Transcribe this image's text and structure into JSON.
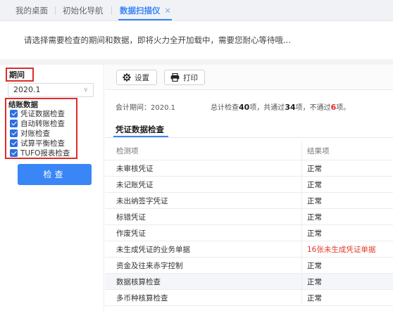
{
  "tabs": [
    {
      "label": "我的桌面"
    },
    {
      "label": "初始化导航"
    },
    {
      "label": "数据扫描仪",
      "active": true,
      "close": "✕"
    }
  ],
  "hint": "请选择需要检查的期间和数据，即将火力全开加载中，需要您耐心等待哦...",
  "left": {
    "period_title": "期间",
    "period_value": "2020.1",
    "group_title": "结账数据",
    "checks": [
      {
        "label": "凭证数据检查",
        "checked": true
      },
      {
        "label": "自动转账检查",
        "checked": true
      },
      {
        "label": "对账检查",
        "checked": true
      },
      {
        "label": "试算平衡检查",
        "checked": true
      },
      {
        "label": "TUFO报表检查",
        "checked": true
      }
    ],
    "check_button": "检查"
  },
  "toolbar": {
    "settings_label": "设置",
    "print_label": "打印"
  },
  "summary": {
    "period_label": "会计期间：2020.1",
    "total_prefix": "总计检查",
    "total": "40",
    "total_unit": "项，共通过",
    "passed": "34",
    "passed_unit": "项，不通过",
    "failed": "6",
    "failed_unit": "项。"
  },
  "section_title": "凭证数据检查",
  "table": {
    "headers": [
      "检测项",
      "结果项"
    ],
    "rows": [
      {
        "item": "未审核凭证",
        "result": "正常",
        "warn": false
      },
      {
        "item": "未记账凭证",
        "result": "正常",
        "warn": false
      },
      {
        "item": "未出纳签字凭证",
        "result": "正常",
        "warn": false
      },
      {
        "item": "标错凭证",
        "result": "正常",
        "warn": false
      },
      {
        "item": "作废凭证",
        "result": "正常",
        "warn": false
      },
      {
        "item": "未生成凭证的业务单据",
        "result": "16张未生成凭证单据",
        "warn": true
      },
      {
        "item": "资金及往来赤字控制",
        "result": "正常",
        "warn": false
      },
      {
        "item": "数据核算检查",
        "result": "正常",
        "warn": false
      },
      {
        "item": "多币种核算检查",
        "result": "正常",
        "warn": false
      }
    ]
  },
  "colors": {
    "accent": "#3a86f7",
    "highlight": "#e02a2a",
    "warn": "#e23a2a"
  }
}
